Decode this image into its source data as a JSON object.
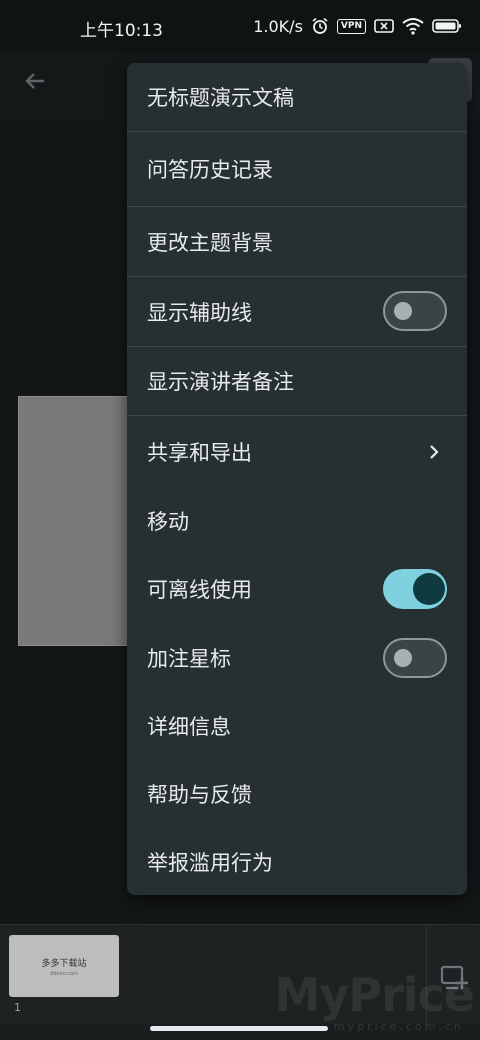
{
  "status_bar": {
    "time": "上午10:13",
    "net_speed": "1.0K/s",
    "vpn": "VPN"
  },
  "menu": {
    "title": "无标题演示文稿",
    "items": [
      {
        "label": "问答历史记录"
      },
      {
        "label": "更改主题背景"
      },
      {
        "label": "显示辅助线",
        "toggle": false
      },
      {
        "label": "显示演讲者备注"
      },
      {
        "label": "共享和导出",
        "submenu": true
      },
      {
        "label": "移动"
      },
      {
        "label": "可离线使用",
        "toggle": true
      },
      {
        "label": "加注星标",
        "toggle": false
      },
      {
        "label": "详细信息"
      },
      {
        "label": "帮助与反馈"
      },
      {
        "label": "举报滥用行为"
      }
    ]
  },
  "slide_strip": {
    "thumb_title": "多多下载站",
    "thumb_subtitle": "ddooo.com",
    "slide_number": "1"
  },
  "watermark": {
    "main": "MyPrice",
    "sub": "myprice.com.cn"
  },
  "colors": {
    "menu_bg": "#263032",
    "toggle_on": "#7fd1df",
    "toggle_knob_on": "#0e3a40"
  },
  "icons": {
    "back": "arrow-left-icon",
    "submenu": "chevron-right-icon",
    "add_slide": "add-slide-icon"
  }
}
